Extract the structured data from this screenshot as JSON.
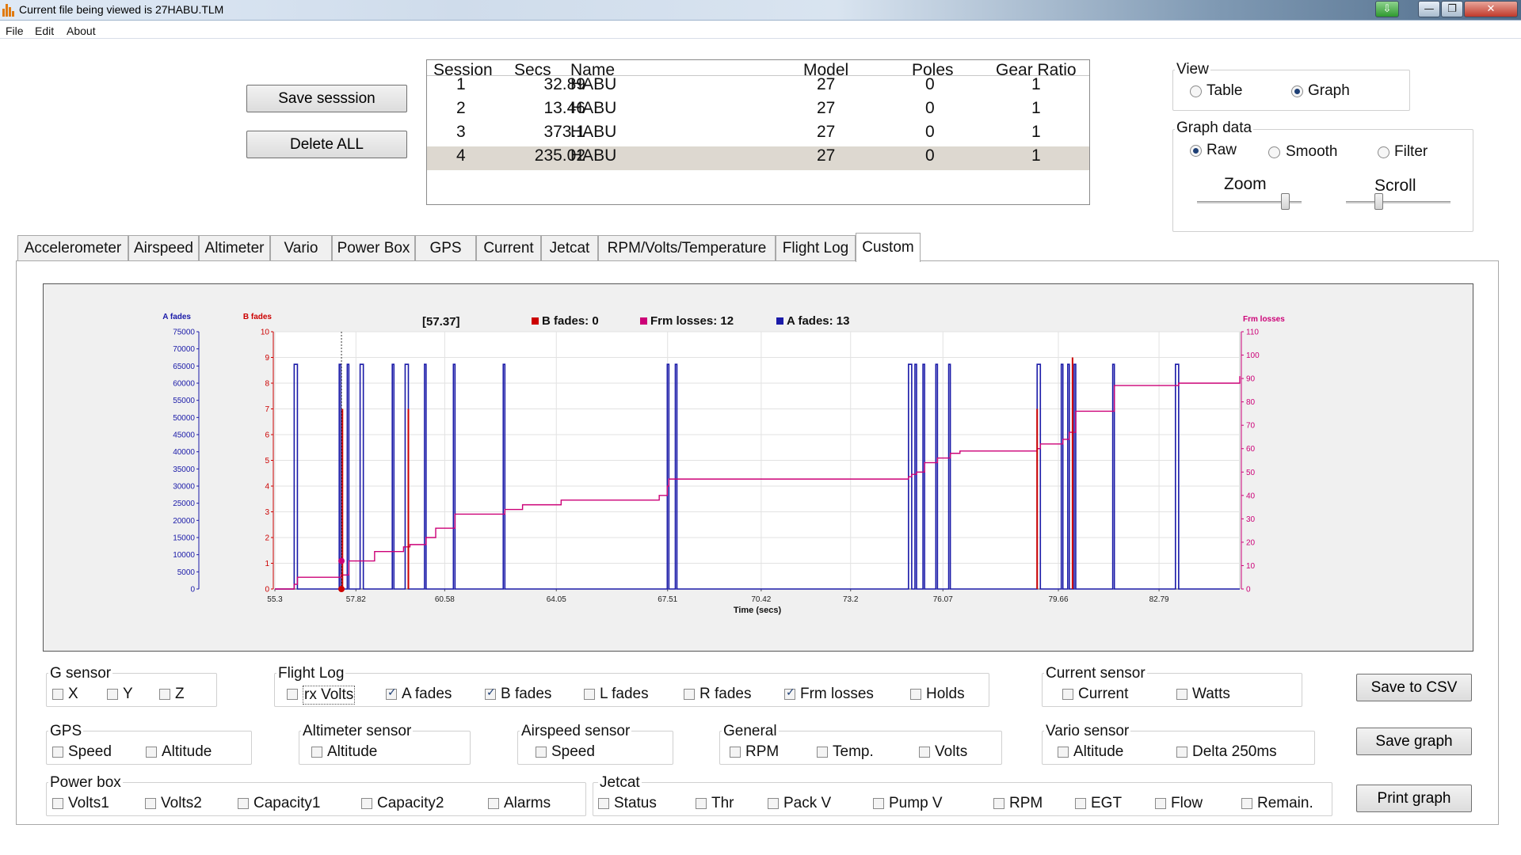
{
  "window": {
    "title": "Current file being viewed is 27HABU.TLM",
    "controls": {
      "extra": "⇩",
      "minimize": "—",
      "maximize": "❐",
      "close": "✕"
    }
  },
  "menu": [
    "File",
    "Edit",
    "About"
  ],
  "buttons": {
    "save_session": "Save sesssion",
    "delete_all": "Delete ALL",
    "save_csv": "Save to CSV",
    "save_graph": "Save graph",
    "print_graph": "Print graph"
  },
  "sessions": {
    "headers": [
      "Session",
      "Secs",
      "Name",
      "Model",
      "Poles",
      "Gear Ratio"
    ],
    "rows": [
      [
        "1",
        "32.89",
        "HABU",
        "27",
        "0",
        "1"
      ],
      [
        "2",
        "13.46",
        "HABU",
        "27",
        "0",
        "1"
      ],
      [
        "3",
        "373.1",
        "HABU",
        "27",
        "0",
        "1"
      ],
      [
        "4",
        "235.02",
        "HABU",
        "27",
        "0",
        "1"
      ]
    ],
    "selected_index": 3
  },
  "view": {
    "title": "View",
    "options": [
      "Table",
      "Graph"
    ],
    "selected": "Graph"
  },
  "graph_data": {
    "title": "Graph data",
    "options": [
      "Raw",
      "Smooth",
      "Filter"
    ],
    "selected": "Raw",
    "zoom_label": "Zoom",
    "scroll_label": "Scroll",
    "zoom_level": 0.88,
    "scroll_level": 0.3
  },
  "tabs": [
    "Accelerometer",
    "Airspeed",
    "Altimeter",
    "Vario",
    "Power Box",
    "GPS",
    "Current",
    "Jetcat",
    "RPM/Volts/Temperature",
    "Flight Log",
    "Custom"
  ],
  "active_tab": "Custom",
  "chart_data": {
    "type": "line",
    "cursor_readout": "[57.37]",
    "cursor_x": 57.37,
    "legend": [
      {
        "label": "B fades: 0",
        "color": "#cc0000"
      },
      {
        "label": "Frm losses: 12",
        "color": "#cc0077"
      },
      {
        "label": "A fades: 13",
        "color": "#1a1aa8"
      }
    ],
    "xlabel": "Time (secs)",
    "xlim": [
      55.3,
      85.3
    ],
    "x_ticks": [
      "55.3",
      "57.82",
      "60.58",
      "64.05",
      "67.51",
      "70.42",
      "73.2",
      "76.07",
      "79.66",
      "82.79"
    ],
    "x_tick_values": [
      55.3,
      57.82,
      60.58,
      64.05,
      67.51,
      70.42,
      73.2,
      76.07,
      79.66,
      82.79
    ],
    "axis_a": {
      "label": "A fades",
      "color": "#1a1aa8",
      "ylim": [
        0,
        75000
      ],
      "ticks": [
        "75000",
        "70000",
        "65000",
        "60000",
        "55000",
        "50000",
        "45000",
        "40000",
        "35000",
        "30000",
        "25000",
        "20000",
        "15000",
        "10000",
        "5000",
        "0"
      ]
    },
    "axis_b": {
      "label": "B fades",
      "color": "#cc0000",
      "ylim": [
        0,
        10
      ],
      "ticks": [
        "10",
        "9",
        "8",
        "7",
        "6",
        "5",
        "4",
        "3",
        "2",
        "1",
        "0"
      ]
    },
    "axis_frm": {
      "label": "Frm losses",
      "color": "#cc0077",
      "ylim": [
        0,
        110
      ],
      "ticks": [
        "110",
        "100",
        "90",
        "80",
        "70",
        "60",
        "50",
        "40",
        "30",
        "20",
        "10",
        "0"
      ]
    },
    "series": [
      {
        "name": "A fades",
        "color": "#1a1aa8",
        "axis": "axis_a",
        "pulse_value": 65500,
        "pulses": [
          [
            55.9,
            56.0
          ],
          [
            57.3,
            57.35
          ],
          [
            57.55,
            57.6
          ],
          [
            57.95,
            58.05
          ],
          [
            58.95,
            59.0
          ],
          [
            59.35,
            59.45
          ],
          [
            59.95,
            60.0
          ],
          [
            60.85,
            60.9
          ],
          [
            62.4,
            62.45
          ],
          [
            67.5,
            67.55
          ],
          [
            67.75,
            67.8
          ],
          [
            75.0,
            75.1
          ],
          [
            75.2,
            75.25
          ],
          [
            75.45,
            75.5
          ],
          [
            75.85,
            75.9
          ],
          [
            76.25,
            76.3
          ],
          [
            79.0,
            79.1
          ],
          [
            79.75,
            79.8
          ],
          [
            79.95,
            80.0
          ],
          [
            80.15,
            80.2
          ],
          [
            81.35,
            81.4
          ],
          [
            83.3,
            83.4
          ]
        ]
      },
      {
        "name": "B fades",
        "color": "#cc0000",
        "axis": "axis_b",
        "spikes": [
          [
            57.4,
            7
          ],
          [
            59.45,
            7
          ],
          [
            79.0,
            7
          ],
          [
            80.1,
            9
          ]
        ]
      },
      {
        "name": "Frm losses",
        "color": "#cc0077",
        "axis": "axis_frm",
        "steps": [
          [
            55.3,
            0
          ],
          [
            55.9,
            2
          ],
          [
            56.0,
            5
          ],
          [
            57.35,
            6
          ],
          [
            57.6,
            12
          ],
          [
            58.4,
            16
          ],
          [
            59.3,
            18
          ],
          [
            59.5,
            19
          ],
          [
            60.0,
            22
          ],
          [
            60.3,
            26
          ],
          [
            60.9,
            32
          ],
          [
            62.45,
            34
          ],
          [
            63.0,
            36
          ],
          [
            64.2,
            38
          ],
          [
            67.25,
            40
          ],
          [
            67.5,
            44
          ],
          [
            67.55,
            47
          ],
          [
            75.0,
            48
          ],
          [
            75.1,
            49
          ],
          [
            75.25,
            50
          ],
          [
            75.5,
            54
          ],
          [
            75.9,
            56
          ],
          [
            76.3,
            58
          ],
          [
            76.6,
            59
          ],
          [
            79.0,
            60
          ],
          [
            79.1,
            62
          ],
          [
            79.8,
            64
          ],
          [
            80.0,
            67
          ],
          [
            80.2,
            76
          ],
          [
            81.4,
            87
          ],
          [
            83.4,
            88
          ],
          [
            85.3,
            91
          ]
        ]
      }
    ],
    "markers": [
      {
        "x": 57.37,
        "axis": "axis_b",
        "y": 0,
        "color": "#cc0000"
      },
      {
        "x": 57.37,
        "axis": "axis_frm",
        "y": 12,
        "color": "#cc0077"
      }
    ]
  },
  "sensors": {
    "g_sensor": {
      "title": "G sensor",
      "items": [
        {
          "label": "X",
          "checked": false
        },
        {
          "label": "Y",
          "checked": false
        },
        {
          "label": "Z",
          "checked": false
        }
      ]
    },
    "flight_log": {
      "title": "Flight Log",
      "items": [
        {
          "label": "rx Volts",
          "checked": false
        },
        {
          "label": "A fades",
          "checked": true
        },
        {
          "label": "B fades",
          "checked": true
        },
        {
          "label": "L fades",
          "checked": false
        },
        {
          "label": "R fades",
          "checked": false
        },
        {
          "label": "Frm losses",
          "checked": true
        },
        {
          "label": "Holds",
          "checked": false
        }
      ]
    },
    "current_sensor": {
      "title": "Current sensor",
      "items": [
        {
          "label": "Current",
          "checked": false
        },
        {
          "label": "Watts",
          "checked": false
        }
      ]
    },
    "gps": {
      "title": "GPS",
      "items": [
        {
          "label": "Speed",
          "checked": false
        },
        {
          "label": "Altitude",
          "checked": false
        }
      ]
    },
    "altimeter_sensor": {
      "title": "Altimeter sensor",
      "items": [
        {
          "label": "Altitude",
          "checked": false
        }
      ]
    },
    "airspeed_sensor": {
      "title": "Airspeed sensor",
      "items": [
        {
          "label": "Speed",
          "checked": false
        }
      ]
    },
    "general": {
      "title": "General",
      "items": [
        {
          "label": "RPM",
          "checked": false
        },
        {
          "label": "Temp.",
          "checked": false
        },
        {
          "label": "Volts",
          "checked": false
        }
      ]
    },
    "vario_sensor": {
      "title": "Vario sensor",
      "items": [
        {
          "label": "Altitude",
          "checked": false
        },
        {
          "label": "Delta 250ms",
          "checked": false
        }
      ]
    },
    "power_box": {
      "title": "Power box",
      "items": [
        {
          "label": "Volts1",
          "checked": false
        },
        {
          "label": "Volts2",
          "checked": false
        },
        {
          "label": "Capacity1",
          "checked": false
        },
        {
          "label": "Capacity2",
          "checked": false
        },
        {
          "label": "Alarms",
          "checked": false
        }
      ]
    },
    "jetcat": {
      "title": "Jetcat",
      "items": [
        {
          "label": "Status",
          "checked": false
        },
        {
          "label": "Thr",
          "checked": false
        },
        {
          "label": "Pack V",
          "checked": false
        },
        {
          "label": "Pump V",
          "checked": false
        },
        {
          "label": "RPM",
          "checked": false
        },
        {
          "label": "EGT",
          "checked": false
        },
        {
          "label": "Flow",
          "checked": false
        },
        {
          "label": "Remain.",
          "checked": false
        }
      ]
    }
  }
}
